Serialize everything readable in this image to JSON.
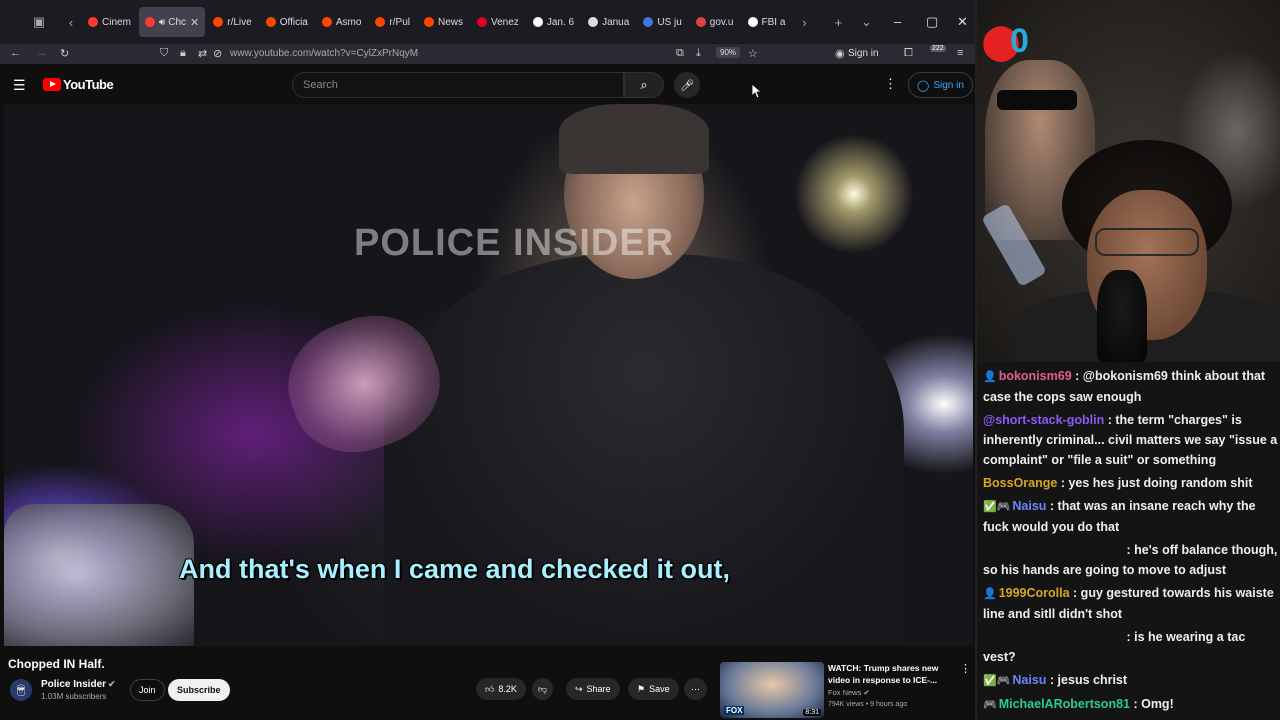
{
  "browser": {
    "tabs": [
      {
        "label": "Cinem",
        "color": "#ff3b30",
        "active": false
      },
      {
        "label": "Chc",
        "color": "#ff3b30",
        "active": true
      },
      {
        "label": "r/Live",
        "color": "#ff4500",
        "active": false
      },
      {
        "label": "Officia",
        "color": "#ff4500",
        "active": false
      },
      {
        "label": "Asmo",
        "color": "#ff4500",
        "active": false
      },
      {
        "label": "r/Pul",
        "color": "#ff4500",
        "active": false
      },
      {
        "label": "News",
        "color": "#ff4500",
        "active": false
      },
      {
        "label": "Venez",
        "color": "#e0002a",
        "active": false
      },
      {
        "label": "Jan. 6",
        "color": "#ffffff",
        "active": false
      },
      {
        "label": "Janua",
        "color": "#dddddd",
        "active": false
      },
      {
        "label": "US ju",
        "color": "#3f7bd6",
        "active": false
      },
      {
        "label": "gov.u",
        "color": "#d9463e",
        "active": false
      },
      {
        "label": "FBI a",
        "color": "#ffffff",
        "active": false
      }
    ],
    "url": "www.youtube.com/watch?v=CylZxPrNqyM",
    "zoom": "90%",
    "sign_in": "Sign in",
    "extension_count": "222"
  },
  "youtube": {
    "logo_text": "YouTube",
    "search_placeholder": "Search",
    "sign_in": "Sign in",
    "video": {
      "watermark": "POLICE INSIDER",
      "caption": "And that's when I came and checked it out,",
      "title": "Chopped IN Half.",
      "channel": "Police Insider",
      "subscribers": "1.03M subscribers",
      "join": "Join",
      "subscribe": "Subscribe",
      "likes": "8.2K",
      "share": "Share",
      "save": "Save"
    },
    "recommended": {
      "title": "WATCH: Trump shares new video in response to ICE-...",
      "channel": "Fox News",
      "meta": "794K views • 9 hours ago",
      "duration": "8:31",
      "thumb_text": "FOX"
    }
  },
  "chat": [
    {
      "user": "bokonism69",
      "user_color": "#e05d8f",
      "badge": "👤",
      "text": " : @bokonism69 think about that case the cops saw enough"
    },
    {
      "user": "@short-stack-goblin",
      "user_color": "#8a5cf5",
      "badge": "",
      "text": " : the term \"charges\" is inherently criminal... civil matters we say \"issue a complaint\" or \"file a suit\" or something"
    },
    {
      "user": "BossOrange",
      "user_color": "#daa520",
      "badge": "",
      "text": " : yes hes just doing random shit"
    },
    {
      "user": "Naisu",
      "user_color": "#6f83ff",
      "badge": "✅🎮",
      "text": " : that was an insane reach why the fuck would you do that"
    },
    {
      "user": "",
      "user_color": "#ffffff",
      "badge": "",
      "text": " : he's off balance though, so his hands are going to move to adjust"
    },
    {
      "user": "1999Corolla",
      "user_color": "#daa520",
      "badge": "👤",
      "text": " : guy gestured towards his waiste line and sitll didn't shot"
    },
    {
      "user": "",
      "user_color": "#ffffff",
      "badge": "",
      "text": " : is he wearing a tac vest?"
    },
    {
      "user": "Naisu",
      "user_color": "#6f83ff",
      "badge": "✅🎮",
      "text": " : jesus christ"
    },
    {
      "user": "MichaelARobertson81",
      "user_color": "#28c99a",
      "badge": "🎮",
      "text": " : Omg!"
    }
  ],
  "stream_overlay": {
    "logo": "0"
  }
}
